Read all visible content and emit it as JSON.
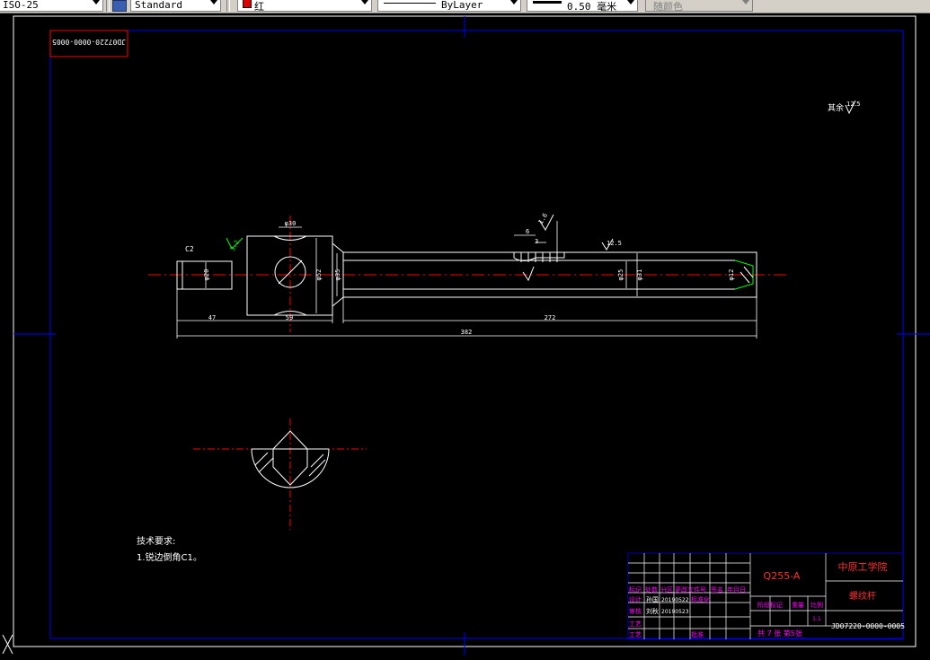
{
  "toolbar": {
    "dimstyle": "ISO-25",
    "textstyle": "Standard",
    "color": "红",
    "linetype": "ByLayer",
    "lineweight": "0.50 毫米",
    "plotstyle": "随颜色",
    "colors": {
      "swatch": "#e00000",
      "background": "#d4d0c8"
    }
  },
  "drawing": {
    "top_code": "JD07220-0000-0005",
    "roughness_note": "其余",
    "roughness_value": "12.5",
    "chamfer_label": "C2",
    "dims": {
      "d_47": "47",
      "d_59": "59",
      "d_272": "272",
      "d_382": "382",
      "d_phi30": "φ30",
      "d_phi20": "φ20",
      "d_phi52": "φ52",
      "d_phi35": "φ35",
      "d_phi25": "φ25",
      "d_phi31": "φ31",
      "d_6": "6",
      "d_3": "3",
      "d_phi12": "φ12",
      "r_3_2": "3.2",
      "r_1_6": "1.6",
      "r_12_5": "12.5"
    },
    "tech_title": "技术要求:",
    "tech_item1": "1.锐边倒角C1。"
  },
  "title_block": {
    "material": "Q255-A",
    "school": "中原工学院",
    "part_name": "螺纹杆",
    "drawing_no": "JD07220-0000-0005",
    "scale": "1:1",
    "sheet_info": "共 7 张  第5张",
    "col_stage": "阶段标记",
    "col_weight": "重量",
    "col_ratio": "比例",
    "row_mark": "标记",
    "row_count": "处数",
    "row_zone": "分区",
    "row_change": "更改文件号",
    "row_sign": "签名",
    "row_date": "年月日",
    "row_design": "设计",
    "row_std": "标准化",
    "row_check": "审核",
    "row_process": "工艺",
    "row_approve": "批准",
    "designer": "孙国",
    "design_date": "20190522",
    "checker": "刘秋",
    "check_date": "20190523",
    "colors": {
      "frame": "#0000ff",
      "text": "#ff00ff",
      "title": "#ff3030",
      "white": "#ffffff"
    }
  }
}
